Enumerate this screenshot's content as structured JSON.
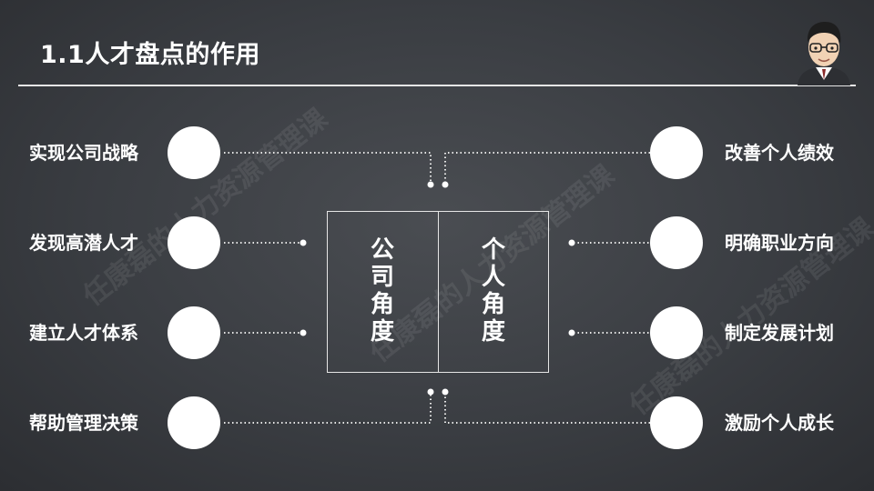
{
  "title": "1.1人才盘点的作用",
  "center": {
    "left_text": "公司角度",
    "right_text": "个人角度"
  },
  "left_items": [
    {
      "label": "实现公司战略"
    },
    {
      "label": "发现高潜人才"
    },
    {
      "label": "建立人才体系"
    },
    {
      "label": "帮助管理决策"
    }
  ],
  "right_items": [
    {
      "label": "改善个人绩效"
    },
    {
      "label": "明确职业方向"
    },
    {
      "label": "制定发展计划"
    },
    {
      "label": "激励个人成长"
    }
  ],
  "watermark": "任康磊的人力资源管理课",
  "colors": {
    "background": "#3a3d42",
    "foreground": "#ffffff",
    "line": "#e6e6e6"
  },
  "icons": {
    "avatar": "cartoon-man-with-glasses-icon"
  }
}
